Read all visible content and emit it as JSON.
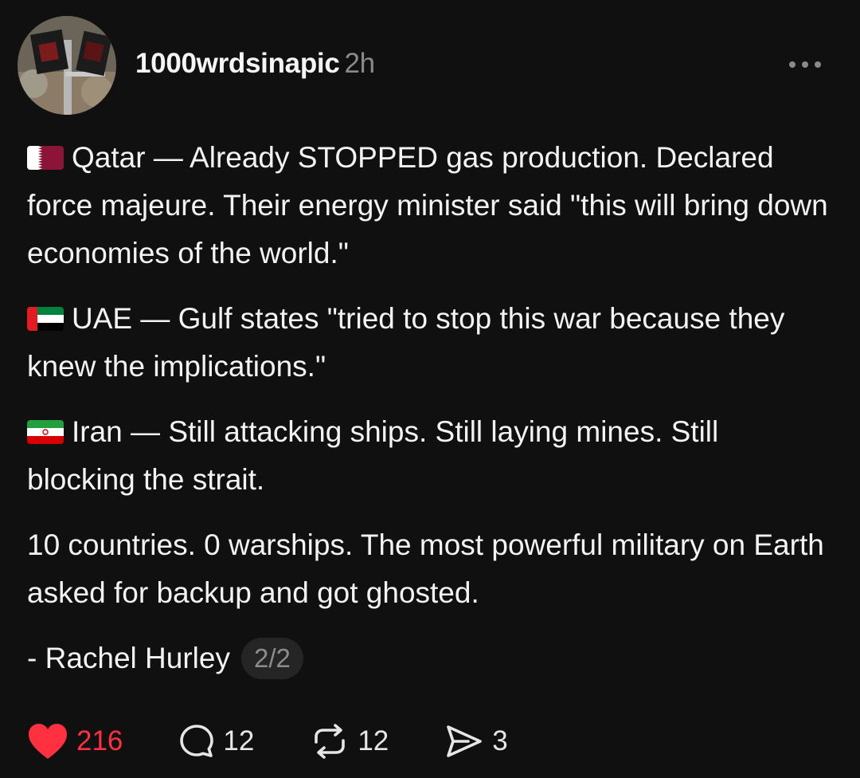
{
  "post": {
    "username": "1000wrdsinapic",
    "timestamp": "2h",
    "paragraphs": [
      {
        "flag": "qatar-flag-icon",
        "text": "Qatar — Already STOPPED gas production. Declared force majeure. Their energy minister said \"this will bring down economies of the world.\""
      },
      {
        "flag": "uae-flag-icon",
        "text": "UAE — Gulf states \"tried to stop this war because they knew the implications.\""
      },
      {
        "flag": "iran-flag-icon",
        "text": "Iran — Still attacking ships. Still laying mines. Still blocking the strait."
      },
      {
        "flag": "",
        "text": "10 countries. 0 warships. The most powerful military on Earth asked for backup and got ghosted."
      }
    ],
    "signature": "- Rachel Hurley",
    "page_indicator": "2/2"
  },
  "actions": {
    "likes": "216",
    "replies": "12",
    "reposts": "12",
    "shares": "3"
  },
  "colors": {
    "background": "#101010",
    "like_accent": "#ff3040",
    "muted_text": "#8a8a8a"
  }
}
